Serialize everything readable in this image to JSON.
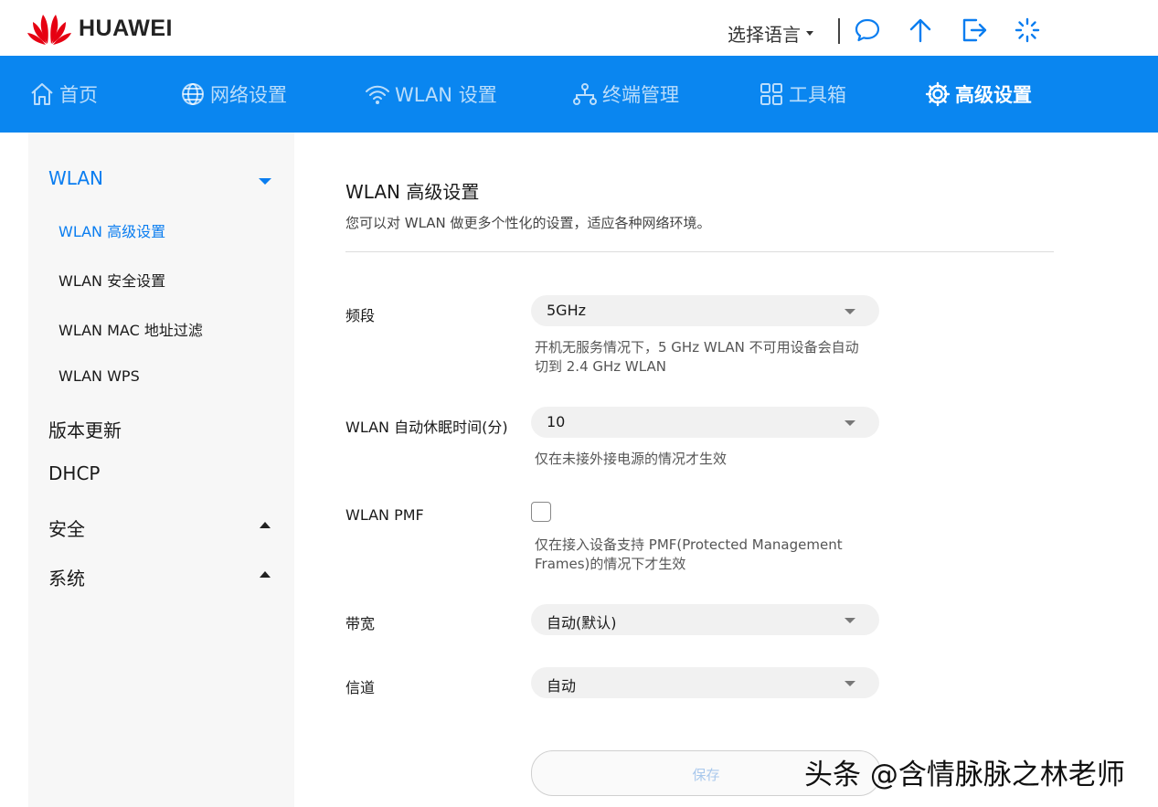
{
  "brand": {
    "name": "HUAWEI",
    "color": "#e60012"
  },
  "header": {
    "language_label": "选择语言",
    "icons": [
      "chat-icon",
      "upload-icon",
      "logout-icon",
      "loading-icon"
    ]
  },
  "nav": {
    "accent": "#0a86f0",
    "items": [
      {
        "label": "首页",
        "icon": "home-icon",
        "active": false
      },
      {
        "label": "网络设置",
        "icon": "globe-icon",
        "active": false
      },
      {
        "label": "WLAN 设置",
        "icon": "wifi-icon",
        "active": false
      },
      {
        "label": "终端管理",
        "icon": "devices-icon",
        "active": false
      },
      {
        "label": "工具箱",
        "icon": "toolbox-icon",
        "active": false
      },
      {
        "label": "高级设置",
        "icon": "gear-icon",
        "active": true
      }
    ]
  },
  "sidebar": {
    "groups": [
      {
        "label": "WLAN",
        "expanded": true,
        "items": [
          "WLAN 高级设置",
          "WLAN 安全设置",
          "WLAN MAC 地址过滤",
          "WLAN WPS"
        ],
        "selected": "WLAN 高级设置"
      },
      {
        "label": "版本更新"
      },
      {
        "label": "DHCP"
      },
      {
        "label": "安全",
        "expanded": false
      },
      {
        "label": "系统",
        "expanded": false
      }
    ]
  },
  "main": {
    "title": "WLAN 高级设置",
    "description": "您可以对 WLAN 做更多个性化的设置，适应各种网络环境。",
    "fields": {
      "band": {
        "label": "频段",
        "value": "5GHz",
        "hint_line1": "开机无服务情况下，5 GHz WLAN 不可用设备会自动",
        "hint_line2": "切到 2.4 GHz WLAN"
      },
      "sleep": {
        "label": "WLAN 自动休眠时间(分)",
        "value": "10",
        "hint": "仅在未接外接电源的情况才生效"
      },
      "pmf": {
        "label": "WLAN PMF",
        "checked": false,
        "hint_line1": "仅在接入设备支持 PMF(Protected Management",
        "hint_line2": "Frames)的情况下才生效"
      },
      "bandwidth": {
        "label": "带宽",
        "value": "自动(默认)"
      },
      "channel": {
        "label": "信道",
        "value": "自动"
      }
    },
    "save_label": "保存"
  },
  "watermark": "头条 @含情脉脉之林老师"
}
